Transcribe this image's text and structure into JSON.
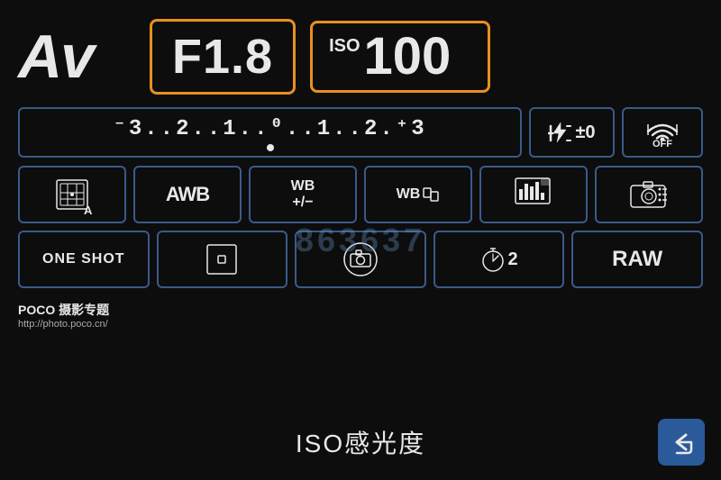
{
  "screen": {
    "mode": "Av",
    "aperture": "F1.8",
    "iso_label": "ISO",
    "iso_value": "100",
    "exposure_scale": "⁻3..2..1..0..1..2.⁺3",
    "flash_comp": "±0",
    "wifi_status": "OFF",
    "metering_mode": "Evaluative",
    "awb": "AWB",
    "wb_shift": "WB\n+/−",
    "wb_bracket": "WB",
    "picture_style": "Picture Style",
    "live_view": "Live",
    "af_mode": "ONE SHOT",
    "af_point": "AF Point",
    "live_view2": "Live View",
    "self_timer": "2",
    "format": "RAW",
    "iso_label_bottom": "ISO感光度",
    "poco_brand": "POCO 摄影专题",
    "poco_url": "http://photo.poco.cn/",
    "back_arrow": "↩",
    "watermark": "863637"
  }
}
